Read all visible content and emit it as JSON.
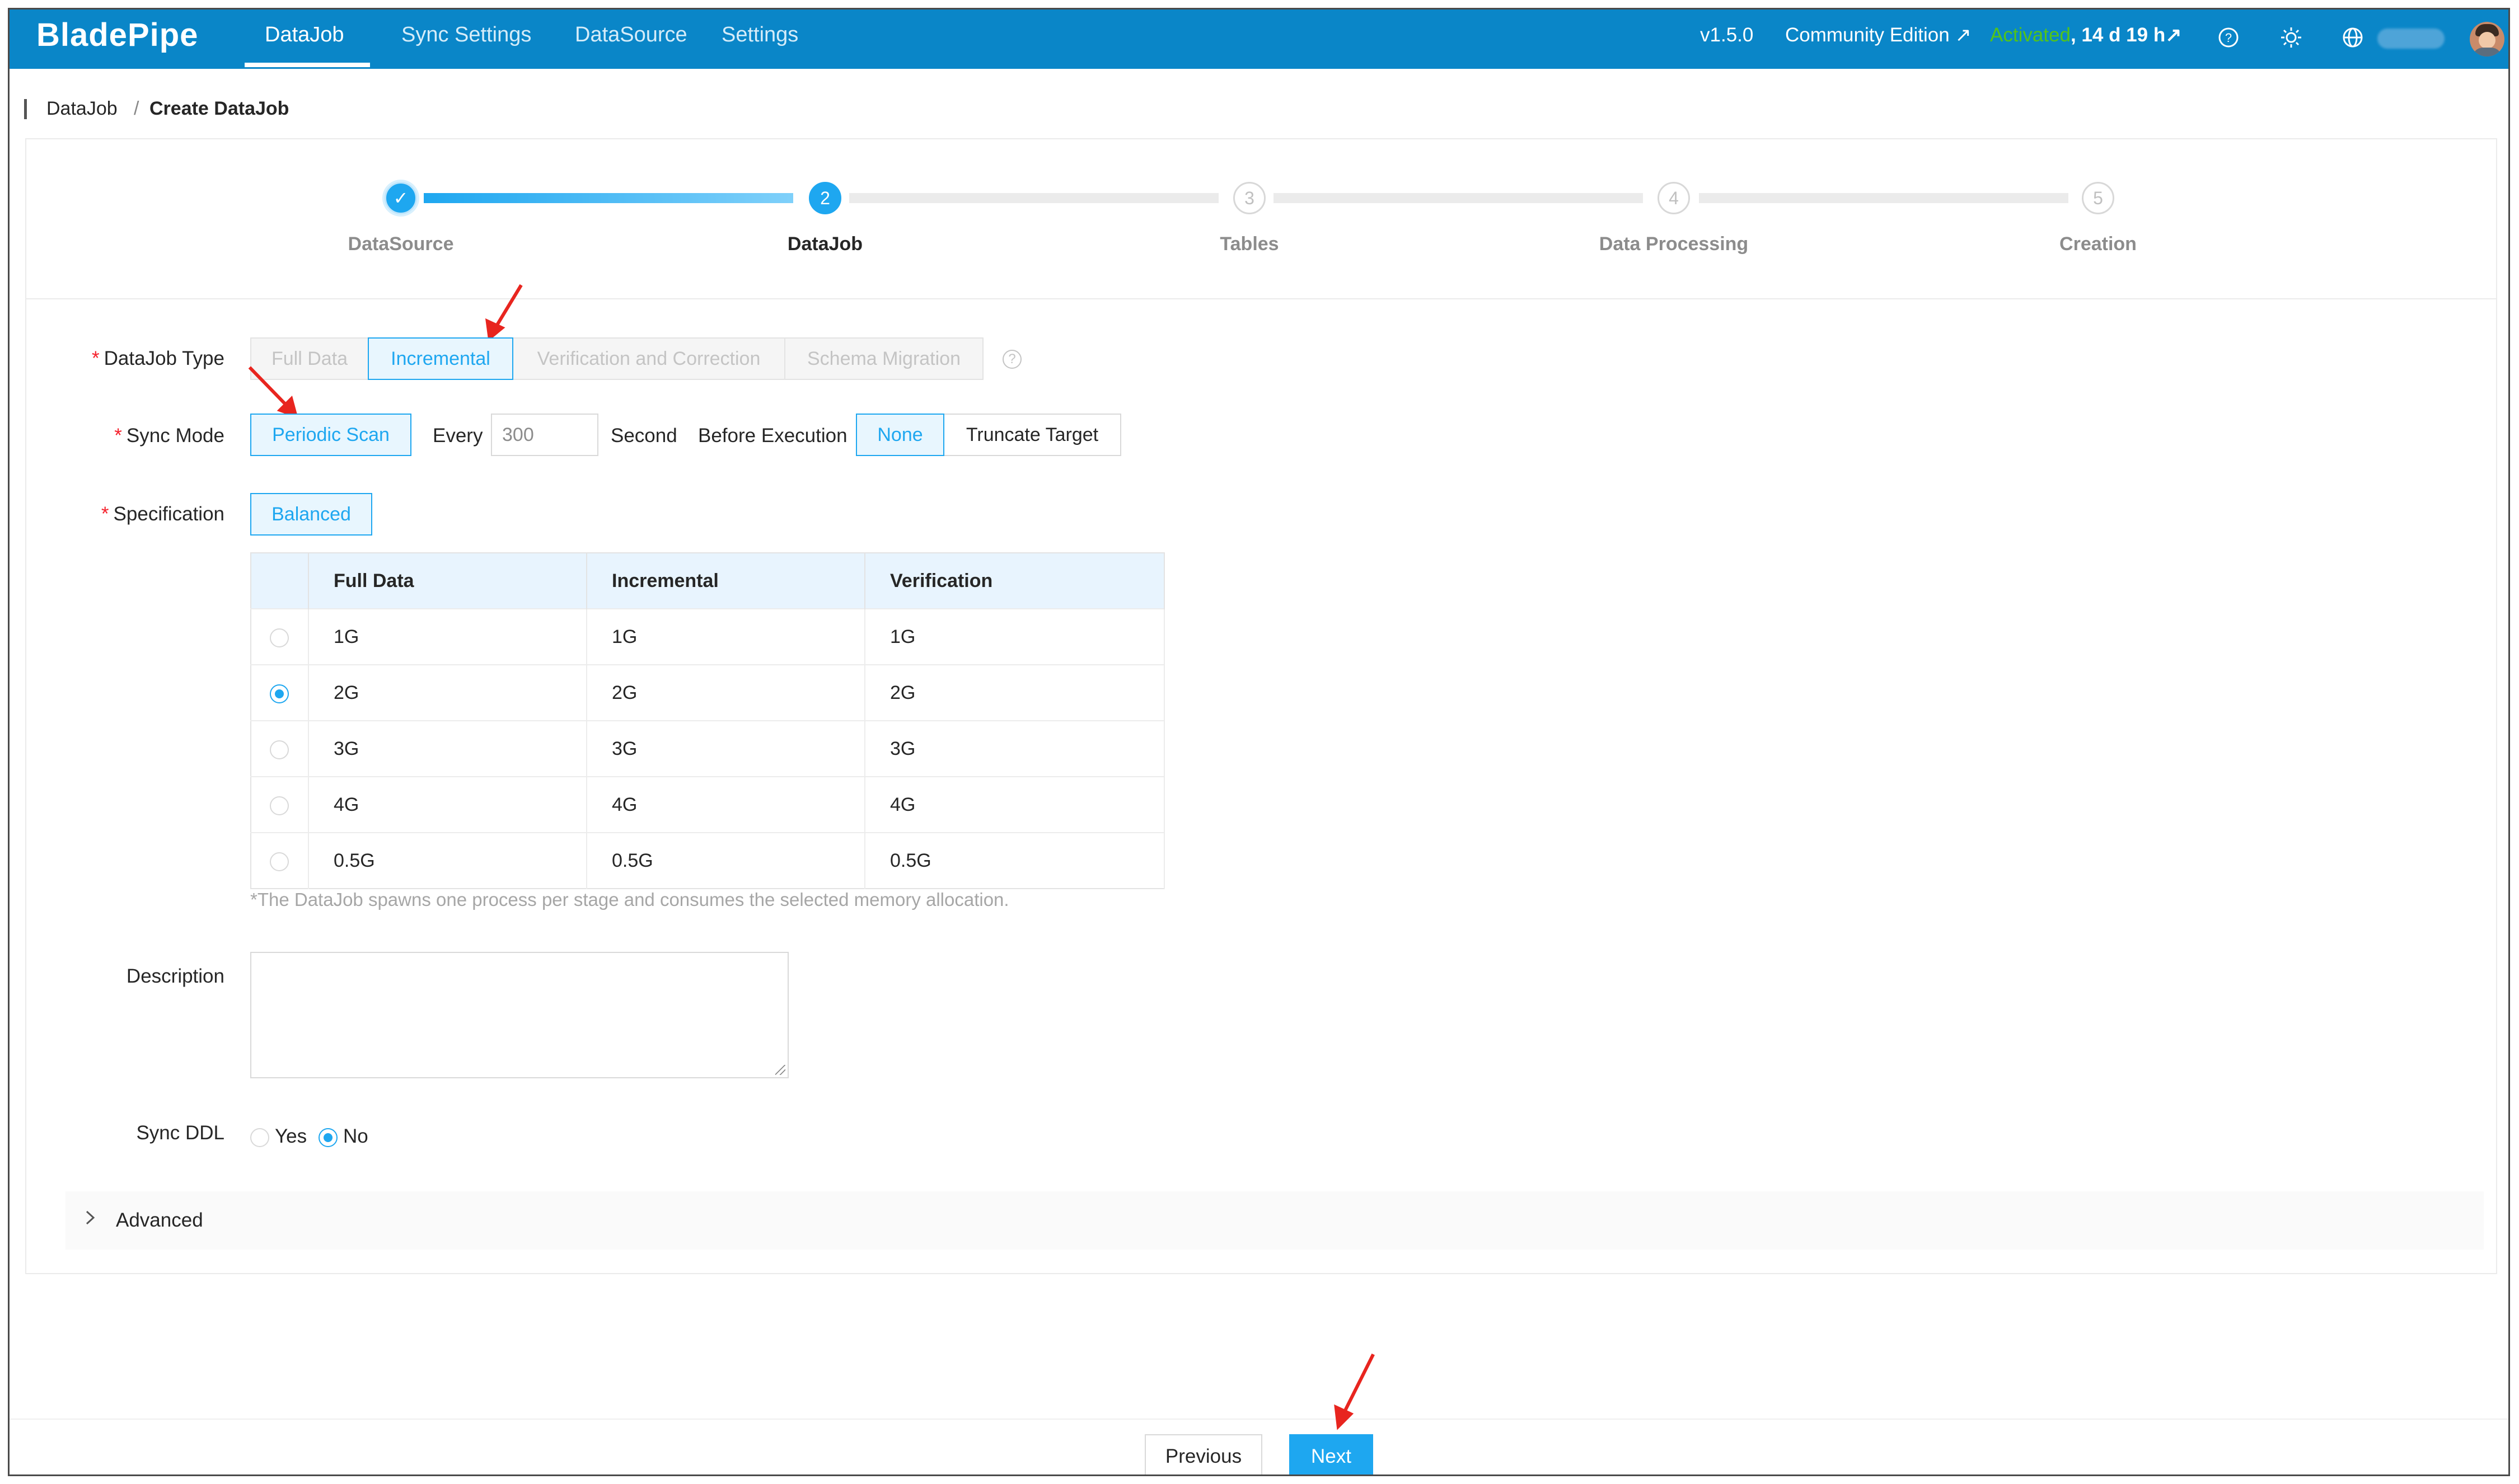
{
  "app": {
    "logo": "BladePipe",
    "nav_tabs": [
      "DataJob",
      "Sync Settings",
      "DataSource",
      "Settings"
    ],
    "version": "v1.5.0",
    "edition": "Community Edition ↗",
    "license_status": "Activated",
    "license_remaining": ", 14 d 19 h↗",
    "accent_color": "#1ea7f0",
    "header_color": "#0a86c8"
  },
  "breadcrumb": {
    "parent": "DataJob",
    "separator": "/",
    "current": "Create DataJob"
  },
  "steps": [
    {
      "number": "✓",
      "label": "DataSource",
      "state": "done"
    },
    {
      "number": "2",
      "label": "DataJob",
      "state": "current"
    },
    {
      "number": "3",
      "label": "Tables",
      "state": "pending"
    },
    {
      "number": "4",
      "label": "Data Processing",
      "state": "pending"
    },
    {
      "number": "5",
      "label": "Creation",
      "state": "pending"
    }
  ],
  "form": {
    "datajob_type": {
      "label": "DataJob Type",
      "options": [
        "Full Data",
        "Incremental",
        "Verification and Correction",
        "Schema Migration"
      ],
      "selected": "Incremental"
    },
    "sync_mode": {
      "label": "Sync Mode",
      "mode": "Periodic Scan",
      "every_label": "Every",
      "interval_placeholder": "300",
      "unit": "Second",
      "before_exec_label": "Before Execution",
      "before_exec_options": [
        "None",
        "Truncate Target"
      ],
      "before_exec_selected": "None"
    },
    "specification": {
      "label": "Specification",
      "value": "Balanced",
      "columns": [
        "Full Data",
        "Incremental",
        "Verification"
      ],
      "rows": [
        {
          "selected": false,
          "cells": [
            "1G",
            "1G",
            "1G"
          ]
        },
        {
          "selected": true,
          "cells": [
            "2G",
            "2G",
            "2G"
          ]
        },
        {
          "selected": false,
          "cells": [
            "3G",
            "3G",
            "3G"
          ]
        },
        {
          "selected": false,
          "cells": [
            "4G",
            "4G",
            "4G"
          ]
        },
        {
          "selected": false,
          "cells": [
            "0.5G",
            "0.5G",
            "0.5G"
          ]
        }
      ],
      "note": "*The DataJob spawns one process per stage and consumes the selected memory allocation."
    },
    "description": {
      "label": "Description",
      "value": ""
    },
    "sync_ddl": {
      "label": "Sync DDL",
      "options": [
        "Yes",
        "No"
      ],
      "selected": "No"
    },
    "advanced_label": "Advanced"
  },
  "footer": {
    "previous_label": "Previous",
    "next_label": "Next"
  }
}
